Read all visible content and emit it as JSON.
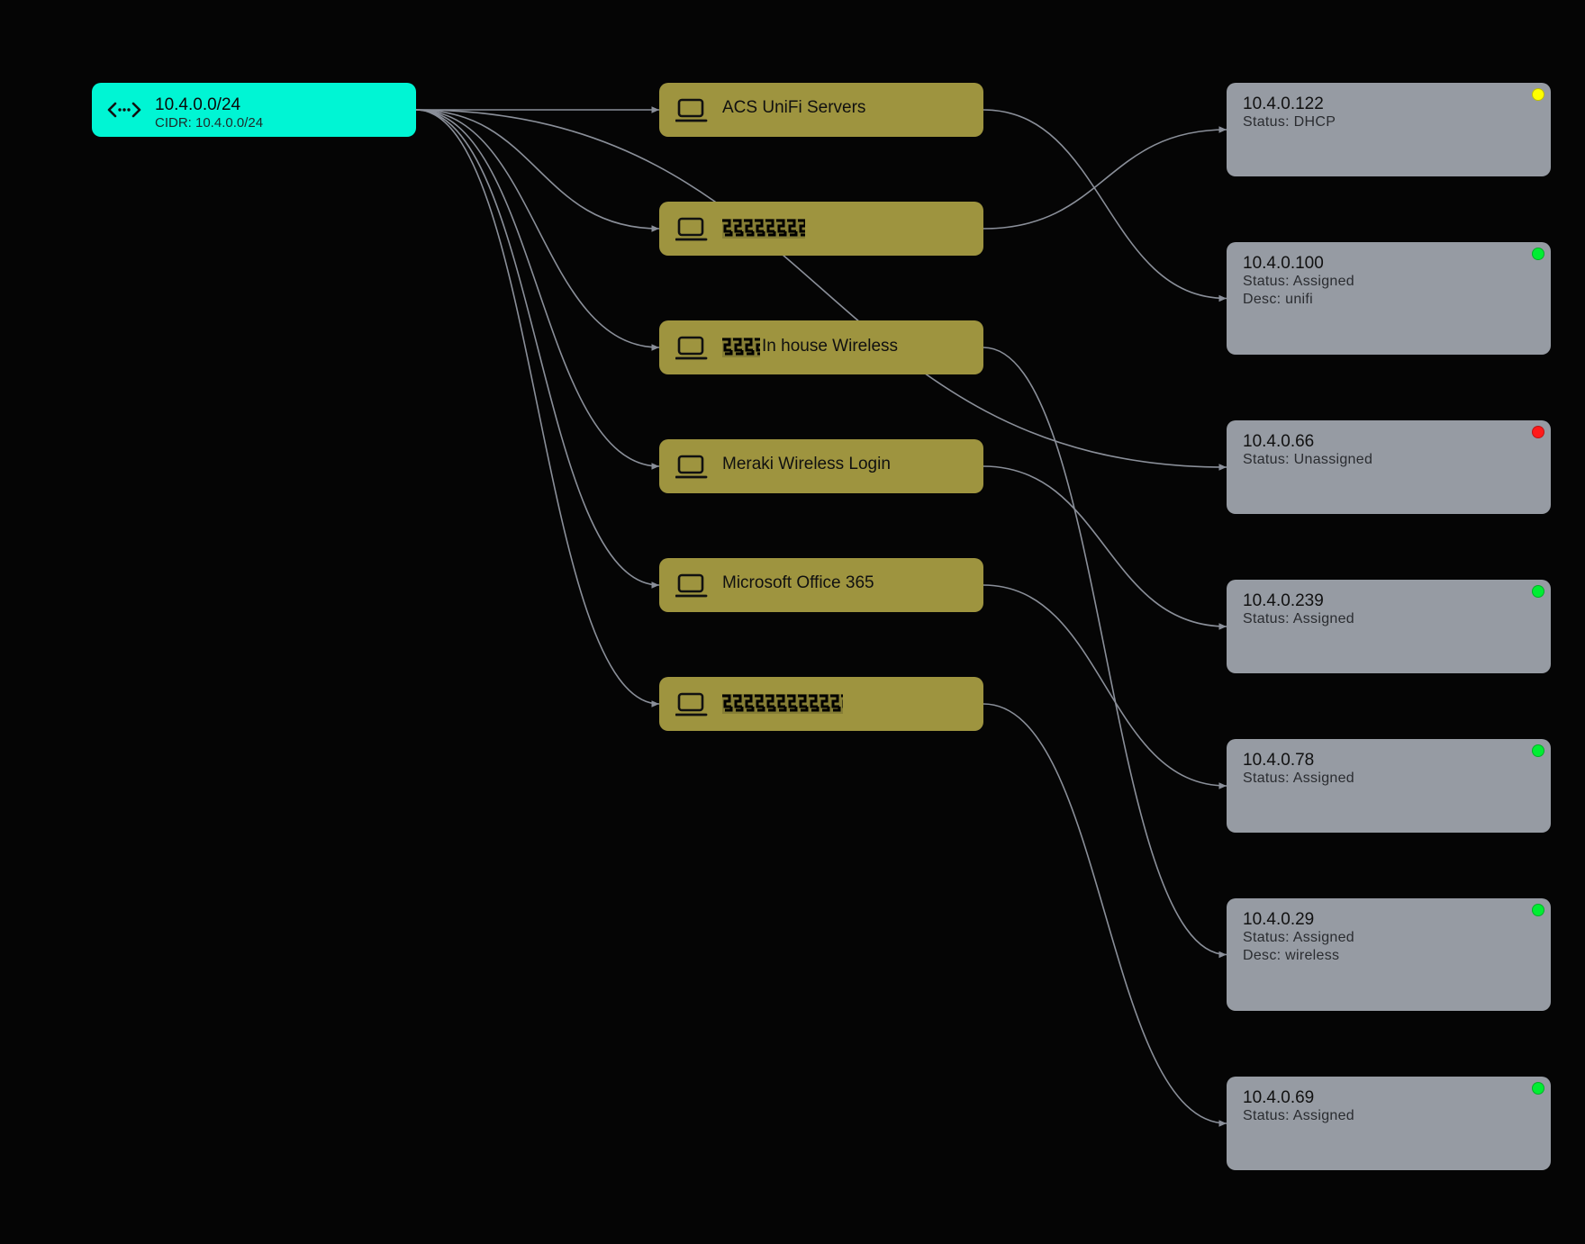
{
  "colors": {
    "background": "#050505",
    "subnet_fill": "#00f5d4",
    "vlan_fill": "#9e943f",
    "ip_fill": "#969ba3",
    "edge": "#8a8f99",
    "status_dhcp": "#ffff00",
    "status_assigned": "#00ee33",
    "status_unassigned": "#ff1a1a"
  },
  "subnet": {
    "title": "10.4.0.0/24",
    "cidr": "CIDR: 10.4.0.0/24",
    "icon": "network-arrows-icon"
  },
  "vlans": [
    {
      "label": "ACS UniFi Servers",
      "redacted": false,
      "icon": "laptop-icon"
    },
    {
      "label": "",
      "redacted": true,
      "icon": "laptop-icon"
    },
    {
      "label": "In house Wireless",
      "redacted": true,
      "icon": "laptop-icon"
    },
    {
      "label": "Meraki Wireless Login",
      "redacted": false,
      "icon": "laptop-icon"
    },
    {
      "label": "Microsoft Office 365",
      "redacted": false,
      "icon": "laptop-icon"
    },
    {
      "label": "",
      "redacted": true,
      "icon": "laptop-icon"
    }
  ],
  "ips": [
    {
      "address": "10.4.0.122",
      "status": "Status: DHCP",
      "desc": "",
      "status_color": "#ffff00"
    },
    {
      "address": "10.4.0.100",
      "status": "Status: Assigned",
      "desc": "Desc: unifi",
      "status_color": "#00ee33"
    },
    {
      "address": "10.4.0.66",
      "status": "Status: Unassigned",
      "desc": "",
      "status_color": "#ff1a1a"
    },
    {
      "address": "10.4.0.239",
      "status": "Status: Assigned",
      "desc": "",
      "status_color": "#00ee33"
    },
    {
      "address": "10.4.0.78",
      "status": "Status: Assigned",
      "desc": "",
      "status_color": "#00ee33"
    },
    {
      "address": "10.4.0.29",
      "status": "Status: Assigned",
      "desc": "Desc: wireless",
      "status_color": "#00ee33"
    },
    {
      "address": "10.4.0.69",
      "status": "Status: Assigned",
      "desc": "",
      "status_color": "#00ee33"
    }
  ],
  "edges": [
    {
      "from": "subnet",
      "to": "vlan-0"
    },
    {
      "from": "subnet",
      "to": "vlan-1"
    },
    {
      "from": "subnet",
      "to": "vlan-2"
    },
    {
      "from": "subnet",
      "to": "vlan-3"
    },
    {
      "from": "subnet",
      "to": "vlan-4"
    },
    {
      "from": "subnet",
      "to": "vlan-5"
    },
    {
      "from": "subnet",
      "to": "ip-2"
    },
    {
      "from": "vlan-0",
      "to": "ip-1"
    },
    {
      "from": "vlan-1",
      "to": "ip-0"
    },
    {
      "from": "vlan-2",
      "to": "ip-5"
    },
    {
      "from": "vlan-3",
      "to": "ip-3"
    },
    {
      "from": "vlan-4",
      "to": "ip-4"
    },
    {
      "from": "vlan-5",
      "to": "ip-6"
    }
  ]
}
